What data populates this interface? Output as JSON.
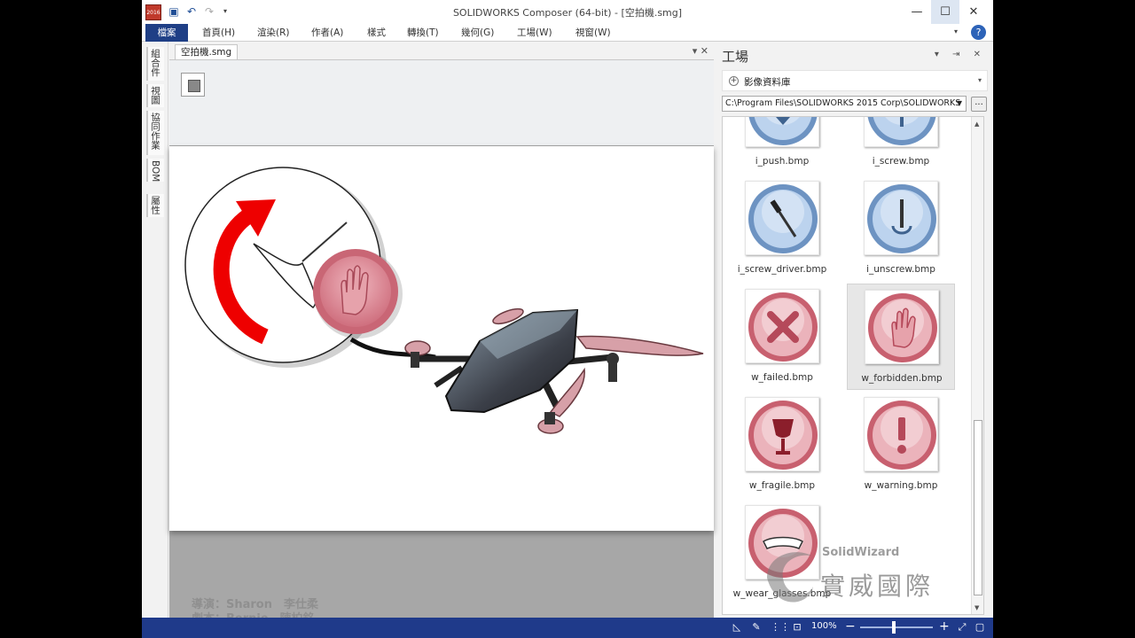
{
  "window": {
    "title": "SOLIDWORKS Composer (64-bit) - [空拍機.smg]",
    "logo_text": "2016",
    "controls": {
      "minimize": "—",
      "maximize": "☐",
      "close": "✕"
    }
  },
  "ribbon": {
    "tabs": [
      "檔案",
      "首頁(H)",
      "渲染(R)",
      "作者(A)",
      "樣式",
      "轉換(T)",
      "幾何(G)",
      "工場(W)",
      "視窗(W)"
    ],
    "help": "?"
  },
  "left_tabs": [
    "組合件",
    "視圖",
    "協同作業",
    "BOM",
    "屬性"
  ],
  "document": {
    "tab_label": "空拍機.smg",
    "tab_controls": "▾ ✕",
    "credits": {
      "line1": "導演：Sharon　李仕柔",
      "line2": "劇本：Bernie　陳柏銘"
    }
  },
  "panel": {
    "title": "工場",
    "controls": "▾ ⇥ ✕",
    "section_title": "影像資料庫",
    "path": "C:\\Program Files\\SOLIDWORKS 2015 Corp\\SOLIDWORKS",
    "browse": "...",
    "items": [
      {
        "label": "i_push.bmp",
        "icon": "push-icon",
        "color": "blue"
      },
      {
        "label": "i_screw.bmp",
        "icon": "screw-icon",
        "color": "blue"
      },
      {
        "label": "i_screw_driver.bmp",
        "icon": "screwdriver-icon",
        "color": "blue"
      },
      {
        "label": "i_unscrew.bmp",
        "icon": "unscrew-icon",
        "color": "blue"
      },
      {
        "label": "w_failed.bmp",
        "icon": "failed-icon",
        "color": "red"
      },
      {
        "label": "w_forbidden.bmp",
        "icon": "forbidden-hand-icon",
        "color": "red",
        "selected": true
      },
      {
        "label": "w_fragile.bmp",
        "icon": "fragile-glass-icon",
        "color": "red"
      },
      {
        "label": "w_warning.bmp",
        "icon": "warning-icon",
        "color": "red"
      },
      {
        "label": "w_wear_glasses.bmp",
        "icon": "glasses-icon",
        "color": "red"
      }
    ],
    "watermark": {
      "brand": "SolidWizard",
      "company": "實威國際"
    }
  },
  "statusbar": {
    "zoom": "100%",
    "minus": "−",
    "plus": "+"
  },
  "colors": {
    "accent": "#1f3f86",
    "statusbar": "#1f3a8a",
    "icon_blue": "#7ea8d8",
    "icon_red": "#d7707f"
  }
}
